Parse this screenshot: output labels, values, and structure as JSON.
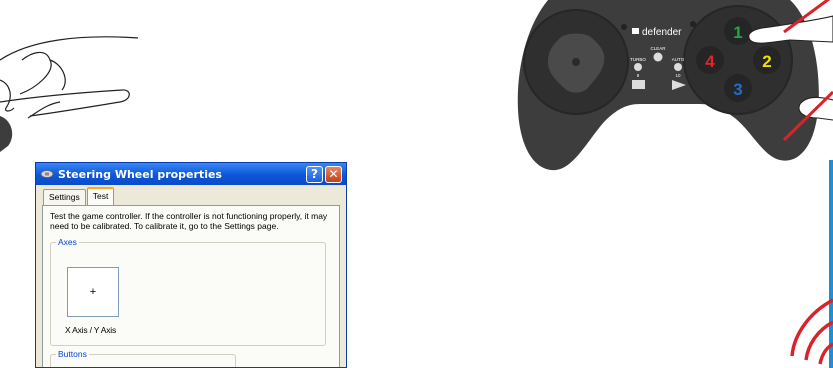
{
  "dialog": {
    "title": "Steering Wheel properties",
    "help_label": "?",
    "close_label": "✕",
    "tabs": [
      {
        "label": "Settings",
        "active": false
      },
      {
        "label": "Test",
        "active": true
      }
    ],
    "description": "Test the game controller.  If the controller is not functioning properly, it may need to be calibrated.  To calibrate it, go to the Settings page.",
    "axes": {
      "legend": "Axes",
      "crosshair": "+",
      "label": "X Axis / Y Axis"
    },
    "buttons": {
      "legend": "Buttons"
    }
  },
  "gamepad": {
    "brand": "defender",
    "clear_label": "CLEAR",
    "turbo_label": "TURBO",
    "auto_label": "AUTO",
    "turbo_num": "9",
    "auto_num": "10",
    "buttons": [
      {
        "label": "1",
        "color": "#1fa84a"
      },
      {
        "label": "2",
        "color": "#f0e000"
      },
      {
        "label": "3",
        "color": "#1d6fd0"
      },
      {
        "label": "4",
        "color": "#e0262b"
      }
    ]
  },
  "colors": {
    "accent_red": "#d9232a",
    "gamepad_body": "#3d3d3d"
  }
}
